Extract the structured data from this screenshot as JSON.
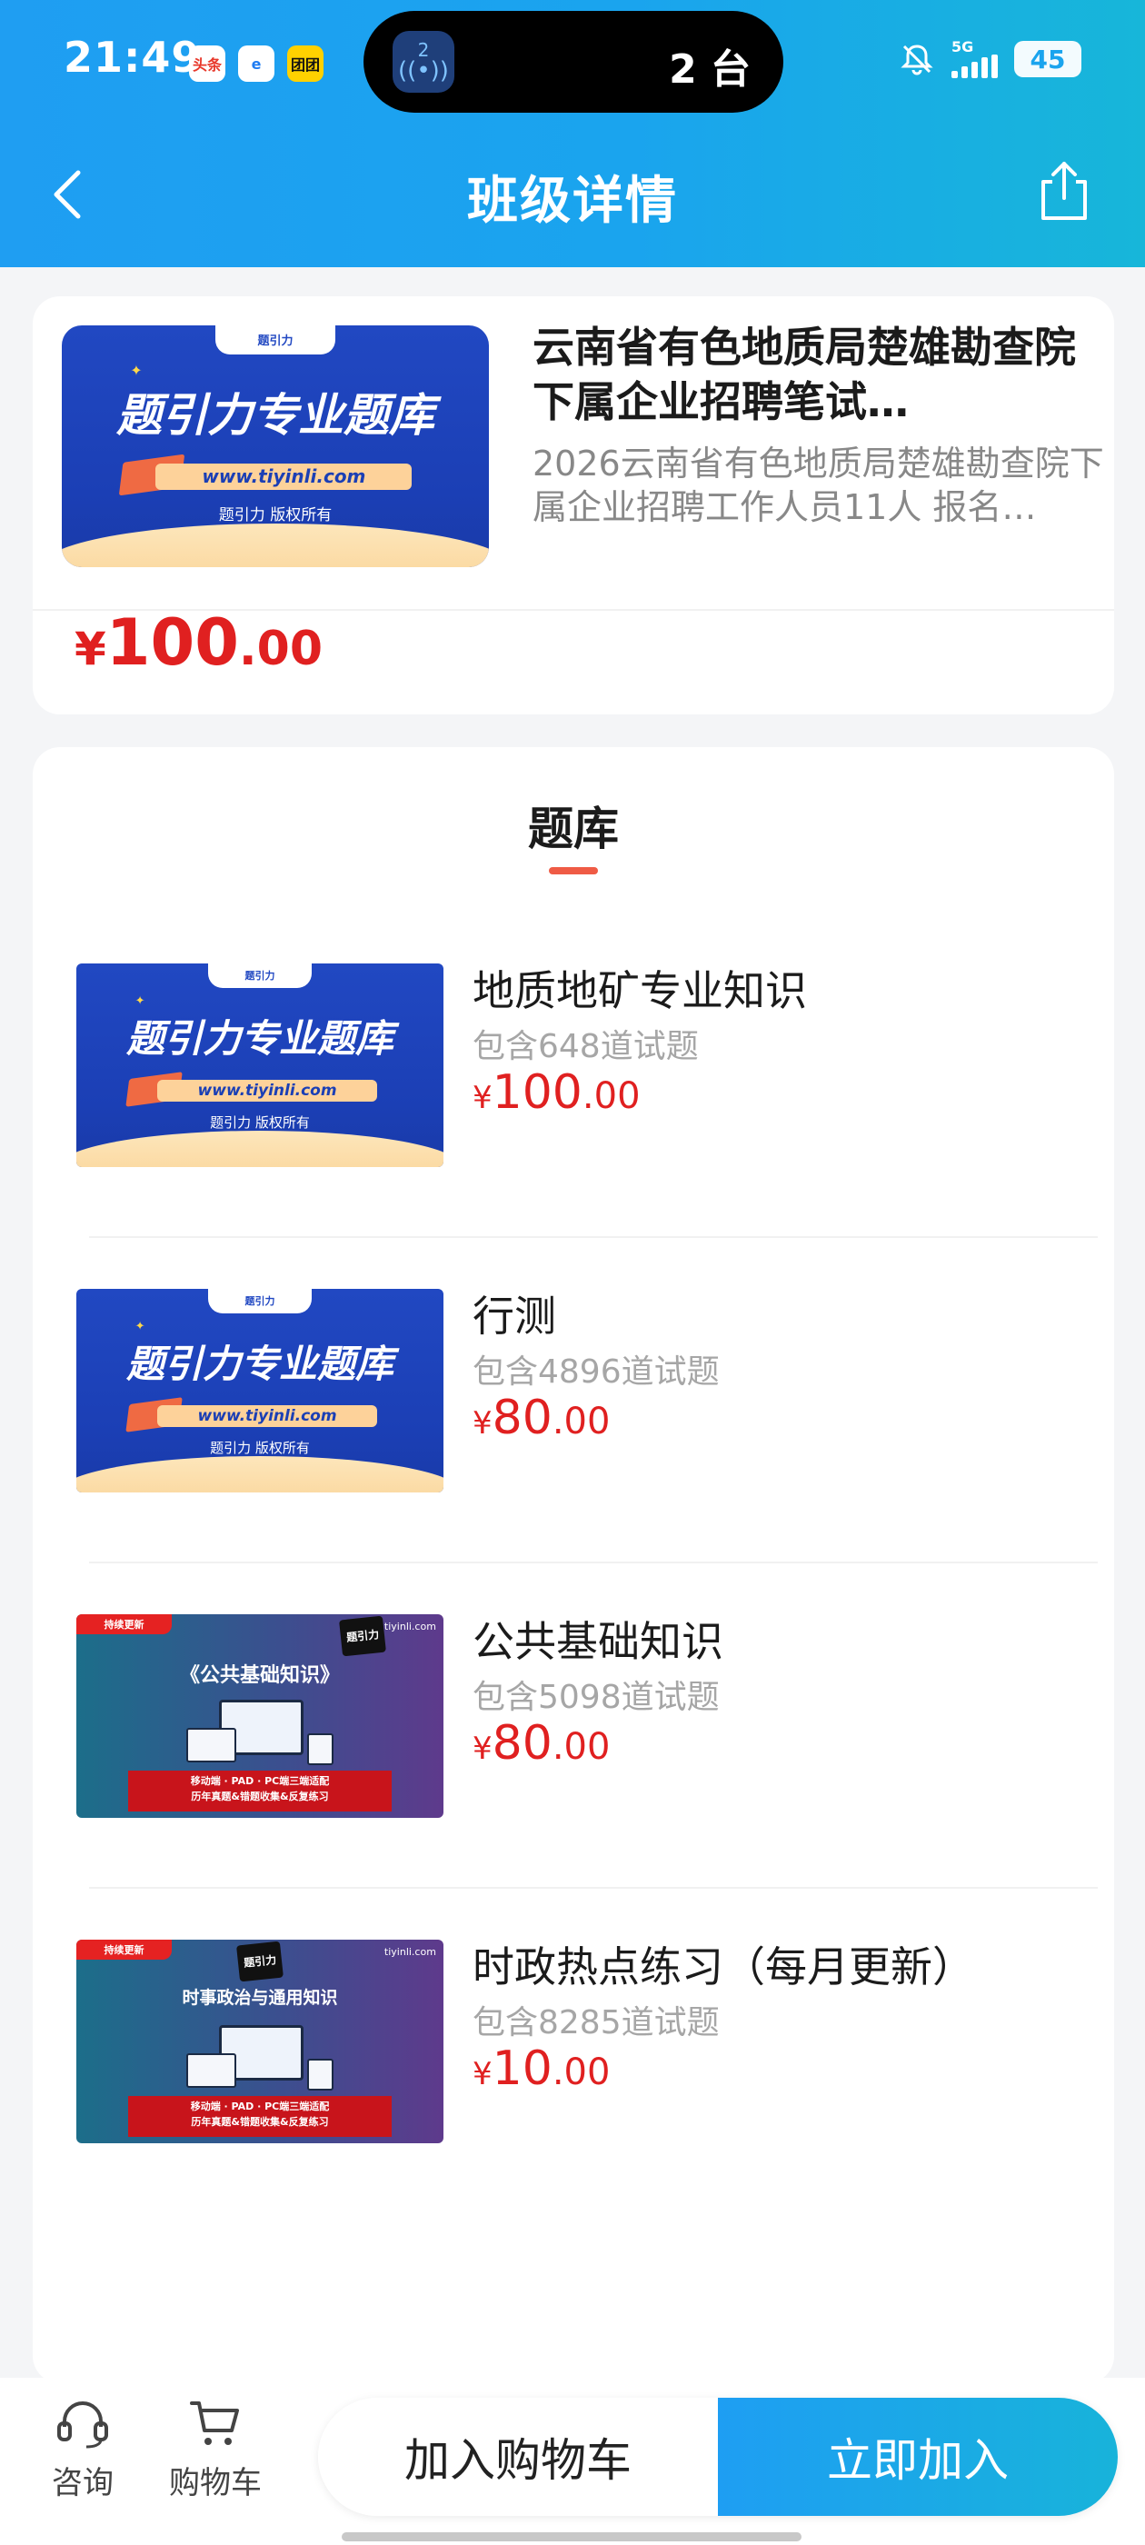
{
  "status_bar": {
    "time": "21:49",
    "badges": [
      "头条",
      "e",
      "团团"
    ],
    "island_app_num": "2",
    "island_text": "2 台",
    "network": "5G",
    "battery": "45"
  },
  "header": {
    "title": "班级详情"
  },
  "course": {
    "thumb": {
      "tab": "题引力",
      "headline": "题引力专业题库",
      "url": "www.tiyinli.com",
      "copyright": "题引力 版权所有"
    },
    "title": "云南省有色地质局楚雄勘查院下属企业招聘笔试…",
    "description": "2026云南省有色地质局楚雄勘查院下属企业招聘工作人员11人 报名…",
    "price": {
      "currency": "¥",
      "integer": "100",
      "decimal": ".00"
    }
  },
  "bank_section": {
    "title": "题库",
    "items": [
      {
        "name": "地质地矿专业知识",
        "count": "包含648道试题",
        "price": {
          "currency": "¥",
          "integer": "100",
          "decimal": ".00"
        },
        "thumb": {
          "tab": "题引力",
          "headline": "题引力专业题库",
          "url": "www.tiyinli.com",
          "copyright": "题引力 版权所有"
        }
      },
      {
        "name": "行测",
        "count": "包含4896道试题",
        "price": {
          "currency": "¥",
          "integer": "80",
          "decimal": ".00"
        },
        "thumb": {
          "tab": "题引力",
          "headline": "题引力专业题库",
          "url": "www.tiyinli.com",
          "copyright": "题引力 版权所有"
        }
      },
      {
        "name": "公共基础知识",
        "count": "包含5098道试题",
        "price": {
          "currency": "¥",
          "integer": "80",
          "decimal": ".00"
        },
        "thumb": {
          "ribbon": "持续更新",
          "logo": "题引力",
          "site": "tiyinli.com",
          "headline": "《公共基础知识》",
          "bar_line1": "移动端 · PAD · PC端三端适配",
          "bar_line2": "历年真题&错题收集&反复练习"
        }
      },
      {
        "name": "时政热点练习（每月更新）",
        "count": "包含8285道试题",
        "price": {
          "currency": "¥",
          "integer": "10",
          "decimal": ".00"
        },
        "thumb": {
          "ribbon": "持续更新",
          "logo": "题引力",
          "site": "tiyinli.com",
          "headline": "时事政治与通用知识",
          "bar_line1": "移动端 · PAD · PC端三端适配",
          "bar_line2": "历年真题&错题收集&反复练习"
        }
      }
    ]
  },
  "bottom_bar": {
    "service_label": "咨询",
    "cart_label": "购物车",
    "add_to_cart_label": "加入购物车",
    "join_label": "立即加入"
  }
}
